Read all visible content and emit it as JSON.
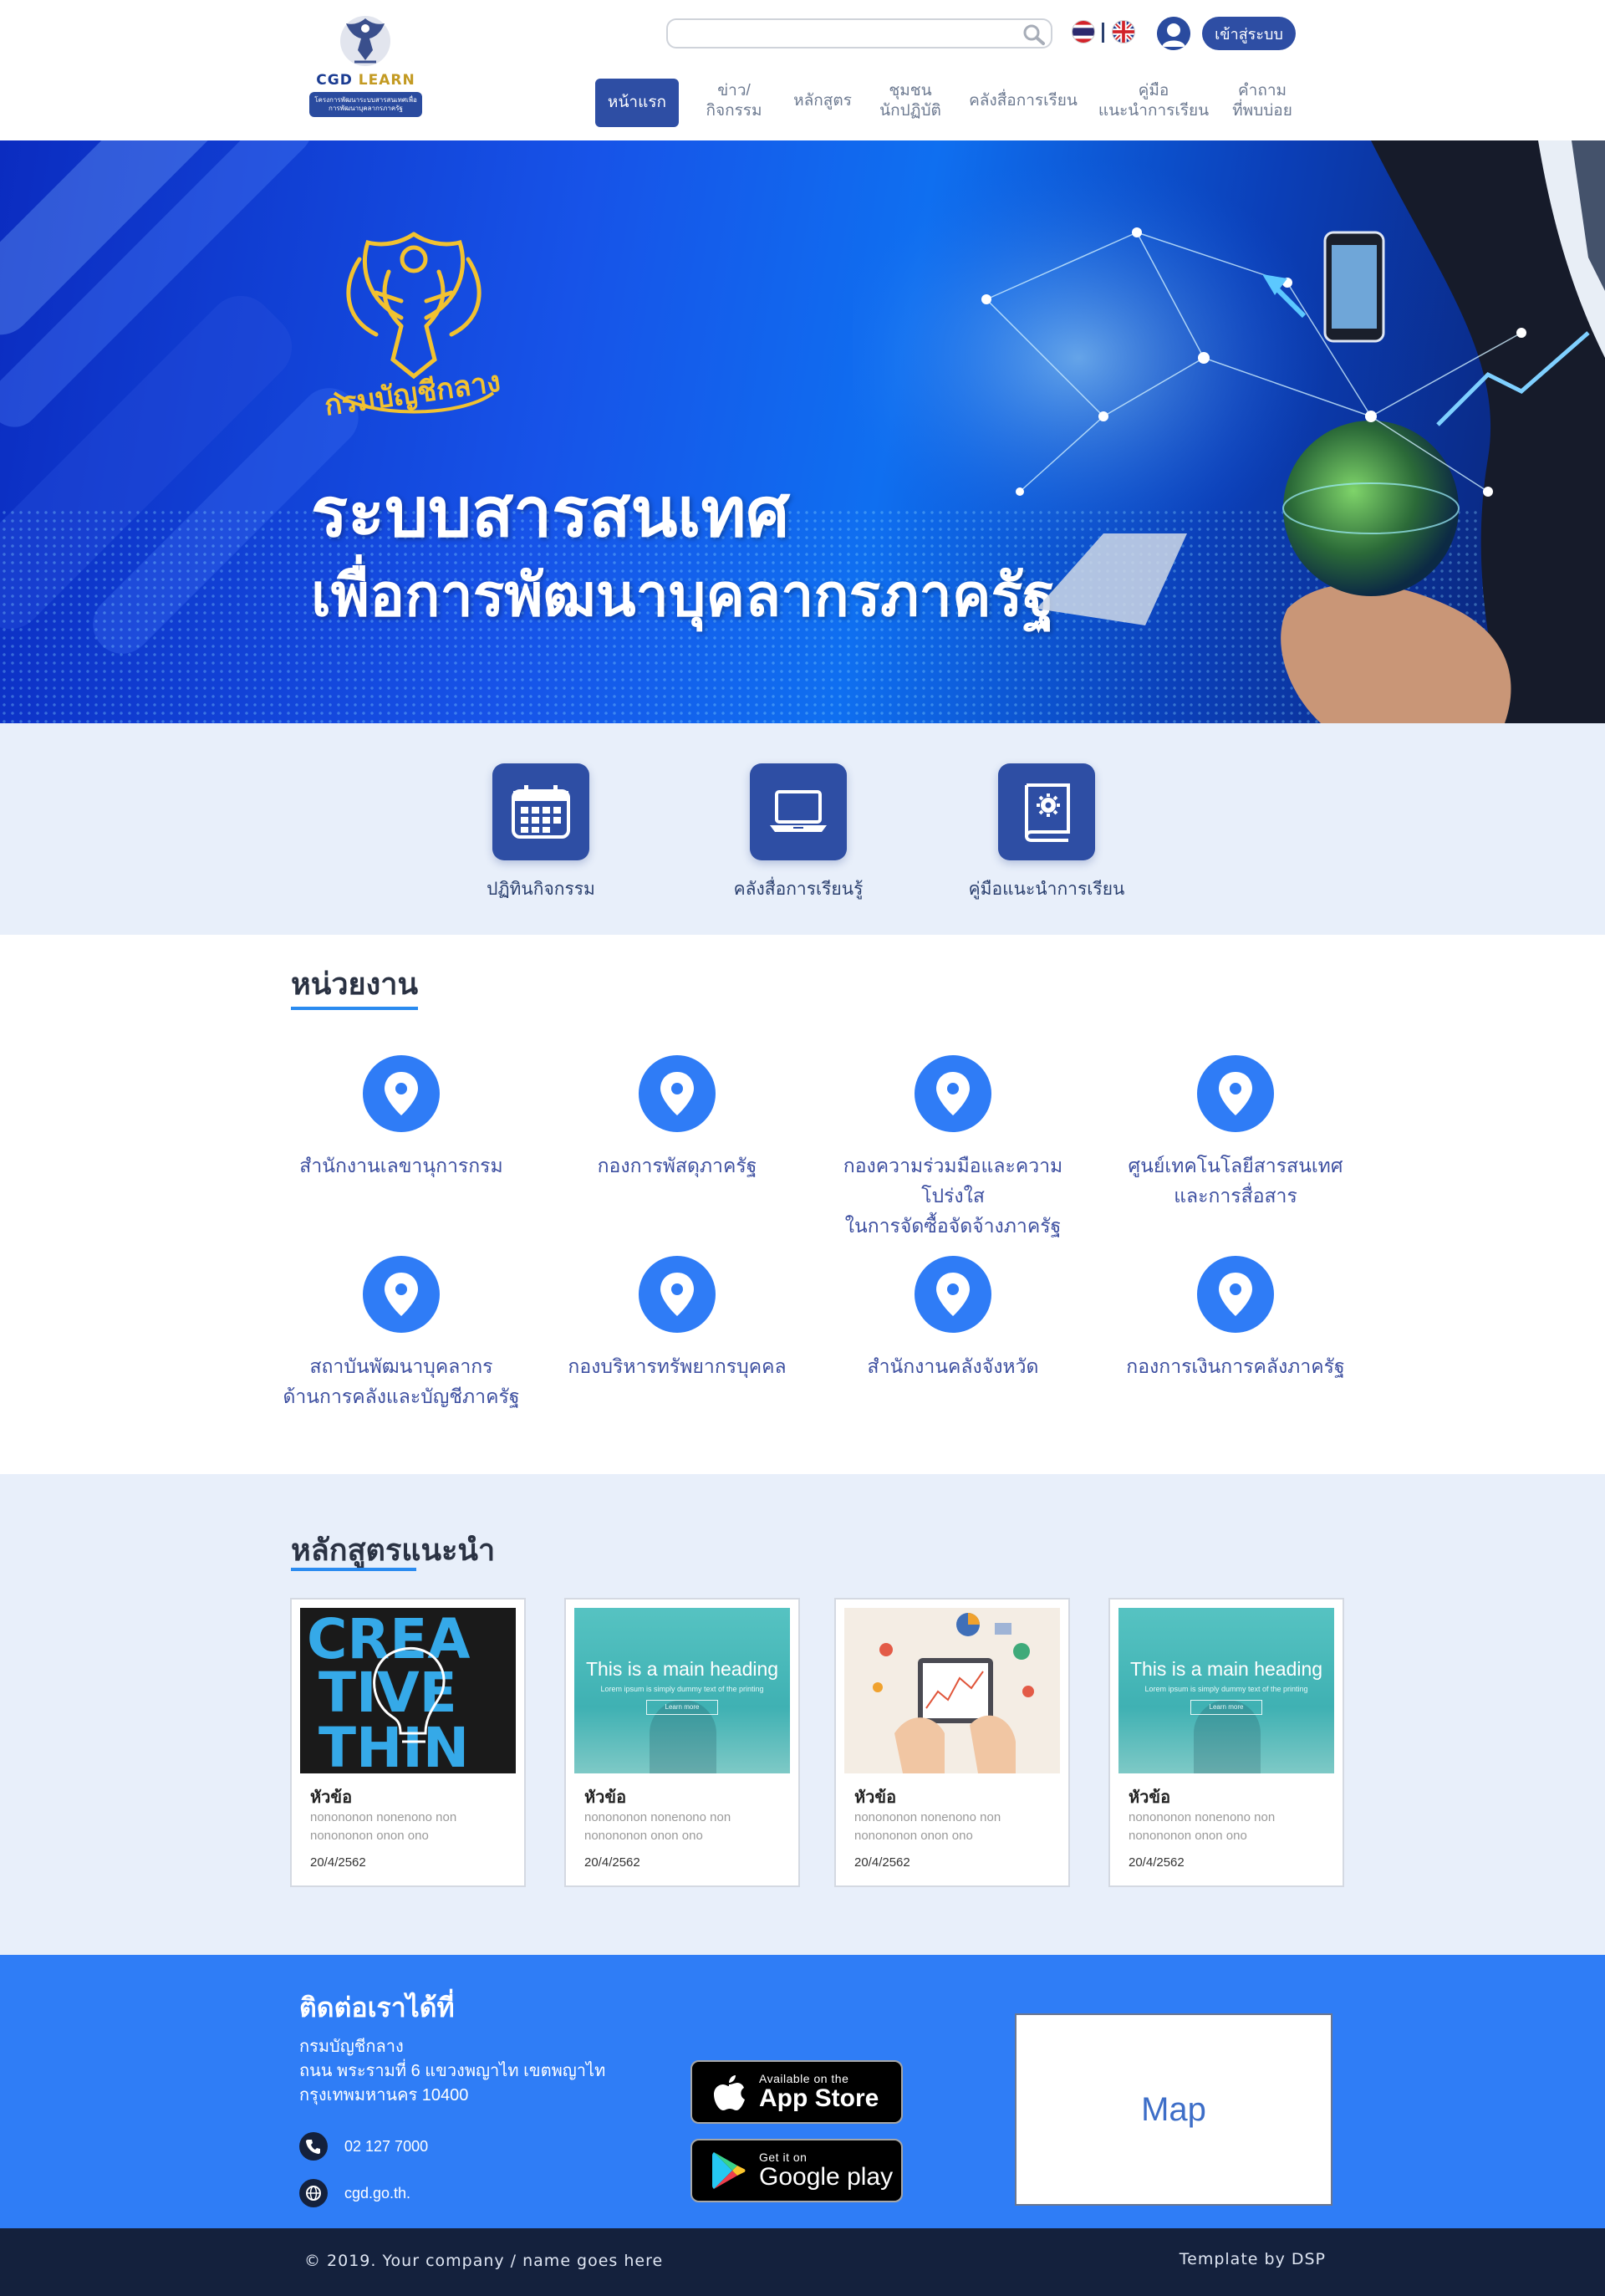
{
  "header": {
    "logo_brand_a": "CGD",
    "logo_brand_b": "LEARN",
    "logo_subtitle": "โครงการพัฒนาระบบสารสนเทศเพื่อการพัฒนาบุคลากรภาครัฐ",
    "search_placeholder": "",
    "login_label": "เข้าสู่ระบบ",
    "nav": [
      {
        "label": "หน้าแรก",
        "active": true
      },
      {
        "label": "ข่าว/\nกิจกรรม"
      },
      {
        "label": "หลักสูตร"
      },
      {
        "label": "ชุมชน\nนักปฏิบัติ"
      },
      {
        "label": "คลังสื่อการเรียน"
      },
      {
        "label": "คู่มือ\nแนะนำการเรียน"
      },
      {
        "label": "คำถาม\nที่พบบ่อย"
      }
    ]
  },
  "hero": {
    "title_line1": "ระบบสารสนเทศ",
    "title_line2": "เพื่อการพัฒนาบุคลากรภาครัฐ",
    "emblem_text": "กรมบัญชีกลาง"
  },
  "quick_links": [
    {
      "label": "ปฏิทินกิจกรรม",
      "icon": "calendar-icon"
    },
    {
      "label": "คลังสื่อการเรียนรู้",
      "icon": "laptop-icon"
    },
    {
      "label": "คู่มือแนะนำการเรียน",
      "icon": "manual-book-icon"
    }
  ],
  "agencies": {
    "title": "หน่วยงาน",
    "items": [
      {
        "name": "สำนักงานเลขานุการกรม"
      },
      {
        "name": "กองการพัสดุภาครัฐ"
      },
      {
        "name": "กองความร่วมมือและความโปร่งใส\nในการจัดซื้อจัดจ้างภาครัฐ"
      },
      {
        "name": "ศูนย์เทคโนโลยีสารสนเทศ\nและการสื่อสาร"
      },
      {
        "name": "สถาบันพัฒนาบุคลากร\nด้านการคลังและบัญชีภาครัฐ"
      },
      {
        "name": "กองบริหารทรัพยากรบุคคล"
      },
      {
        "name": "สำนักงานคลังจังหวัด"
      },
      {
        "name": "กองการเงินการคลังภาครัฐ"
      }
    ]
  },
  "courses": {
    "title": "หลักสูตรแนะนำ",
    "thumb_heading": "This is a main heading",
    "thumb_sub": "Lorem ipsum is simply dummy text of the printing",
    "thumb_btn": "Learn more",
    "creative_text": [
      "CREA",
      "TIVE",
      "THIN"
    ],
    "items": [
      {
        "title": "หัวข้อ",
        "desc": "nonononon  nonenono non nonononon onon ono",
        "date": "20/4/2562",
        "thumb": "creative"
      },
      {
        "title": "หัวข้อ",
        "desc": "nonononon  nonenono non nonononon onon ono",
        "date": "20/4/2562",
        "thumb": "teal"
      },
      {
        "title": "หัวข้อ",
        "desc": "nonononon  nonenono non nonononon onon ono",
        "date": "20/4/2562",
        "thumb": "tablet"
      },
      {
        "title": "หัวข้อ",
        "desc": "nonononon  nonenono non nonononon onon ono",
        "date": "20/4/2562",
        "thumb": "teal"
      }
    ]
  },
  "footer": {
    "title": "ติดต่อเราได้ที่",
    "address": [
      "กรมบัญชีกลาง",
      "ถนน พระรามที่ 6 แขวงพญาไท เขตพญาไท",
      "กรุงเทพมหานคร 10400"
    ],
    "phone": "02 127 7000",
    "website": "cgd.go.th.",
    "appstore_small": "Available on the",
    "appstore_big": "App Store",
    "googleplay_small": "Get it on",
    "googleplay_big": "Google play",
    "map_label": "Map",
    "copyright": "© 2019. Your company / name goes here",
    "template_credit": "Template by DSP"
  },
  "colors": {
    "primary": "#2e4ea4",
    "accent_blue": "#2f7cf6",
    "footer_dark": "#14213d",
    "light_bg": "#e8effa"
  }
}
